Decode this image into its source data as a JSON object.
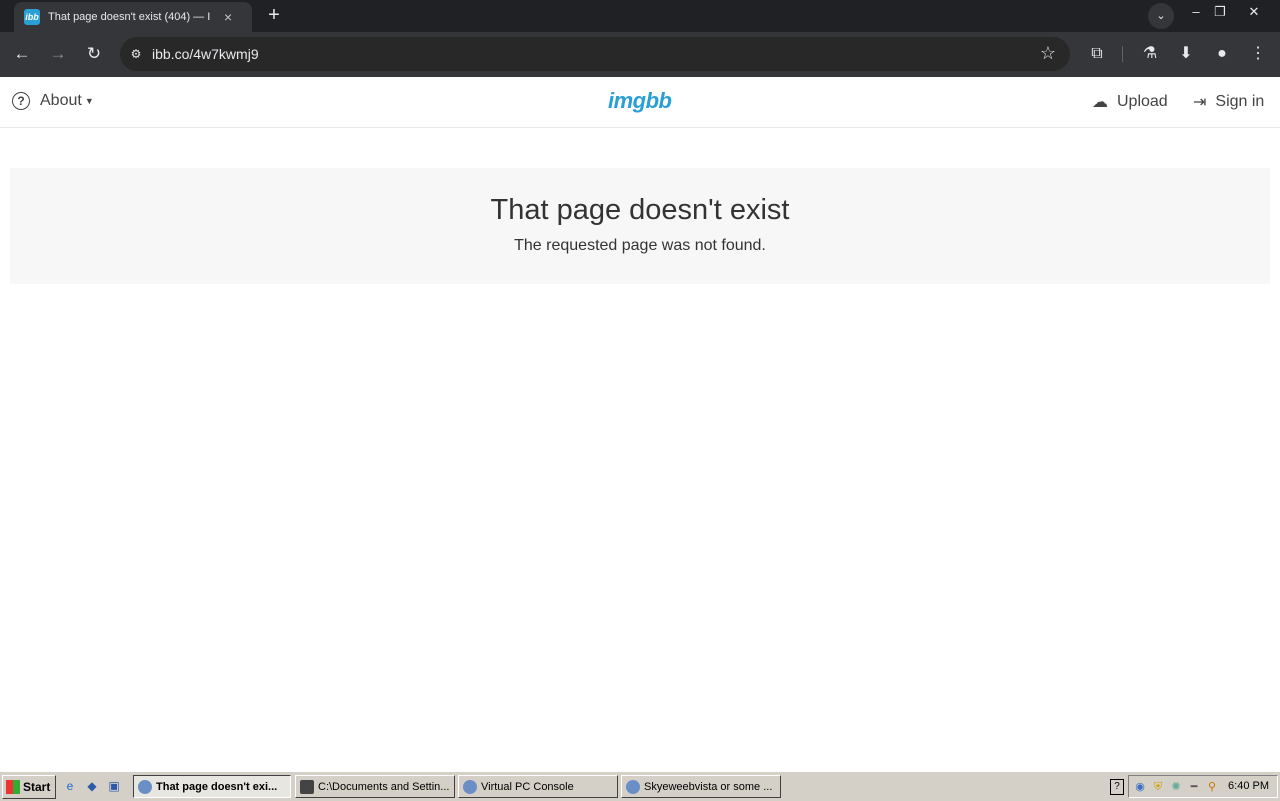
{
  "browser": {
    "tab_title": "That page doesn't exist (404) — I",
    "tab_favicon": "ibb",
    "new_tab": "+",
    "tab_list": "⌄",
    "close": "×",
    "url": "ibb.co/4w7kwmj9",
    "window_buttons": {
      "minimize": "–",
      "restore": "❐",
      "close": "✕"
    }
  },
  "site": {
    "about_label": "About",
    "logo": "imgbb",
    "upload_label": "Upload",
    "signin_label": "Sign in"
  },
  "error": {
    "title": "That page doesn't exist",
    "message": "The requested page was not found."
  },
  "taskbar": {
    "start_label": "Start",
    "tasks": [
      {
        "label": "That page doesn't exi..."
      },
      {
        "label": "C:\\Documents and Settin..."
      },
      {
        "label": "Virtual PC Console"
      },
      {
        "label": "Skyeweebvista or some ..."
      }
    ],
    "clock": "6:40 PM"
  },
  "colors": {
    "brand": "#2a9fd6"
  }
}
